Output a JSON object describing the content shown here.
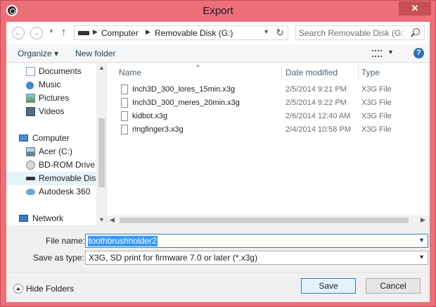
{
  "window": {
    "title": "Export",
    "close_glyph": "✕"
  },
  "nav": {
    "back_glyph": "←",
    "forward_glyph": "→",
    "up_glyph": "↑",
    "breadcrumb": [
      "Computer",
      "Removable Disk (G:)"
    ],
    "search_placeholder": "Search Removable Disk (G:)"
  },
  "toolbar": {
    "organize_label": "Organize ▾",
    "new_folder_label": "New folder",
    "help_glyph": "?"
  },
  "sidebar": {
    "items": [
      {
        "label": "Documents",
        "icon": "documents-icon"
      },
      {
        "label": "Music",
        "icon": "music-icon"
      },
      {
        "label": "Pictures",
        "icon": "pictures-icon"
      },
      {
        "label": "Videos",
        "icon": "videos-icon"
      },
      {
        "label": "Computer",
        "icon": "computer-icon"
      },
      {
        "label": "Acer (C:)",
        "icon": "hard-drive-icon"
      },
      {
        "label": "BD-ROM Drive (F",
        "icon": "disc-drive-icon"
      },
      {
        "label": "Removable Disk (",
        "icon": "removable-drive-icon",
        "selected": true
      },
      {
        "label": "Autodesk 360",
        "icon": "cloud-icon"
      },
      {
        "label": "Network",
        "icon": "network-icon"
      }
    ]
  },
  "file_list": {
    "columns": [
      "Name",
      "Date modified",
      "Type"
    ],
    "rows": [
      {
        "name": "Inch3D_300_lores_15min.x3g",
        "date": "2/5/2014 9:21 PM",
        "type": "X3G File"
      },
      {
        "name": "Inch3D_300_meres_20min.x3g",
        "date": "2/5/2014 9:22 PM",
        "type": "X3G File"
      },
      {
        "name": "kidbot.x3g",
        "date": "2/6/2014 12:40 AM",
        "type": "X3G File"
      },
      {
        "name": "ringfinger3.x3g",
        "date": "2/4/2014 10:58 PM",
        "type": "X3G File"
      }
    ]
  },
  "form": {
    "file_name_label": "File name:",
    "file_name_value": "toothbrushholder2",
    "save_type_label": "Save as type:",
    "save_type_value": "X3G, SD print for firmware 7.0 or later (*.x3g)"
  },
  "footer": {
    "hide_folders_label": "Hide Folders",
    "save_label": "Save",
    "cancel_label": "Cancel"
  },
  "colors": {
    "frame": "#ec6f79",
    "accent": "#3399ff"
  }
}
